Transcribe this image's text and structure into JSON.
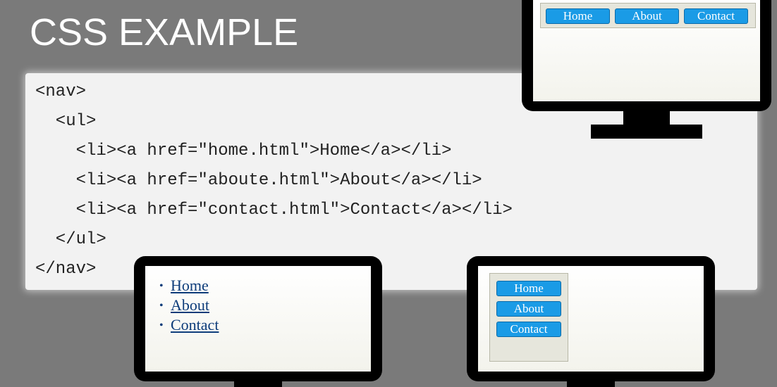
{
  "slide": {
    "title": "CSS EXAMPLE"
  },
  "code": {
    "lines": [
      "<nav>",
      "  <ul>",
      "    <li><a href=\"home.html\">Home</a></li>",
      "    <li><a href=\"aboute.html\">About</a></li>",
      "    <li><a href=\"contact.html\">Contact</a></li>",
      "  </ul>",
      "</nav>"
    ]
  },
  "monitor_top_right": {
    "nav_items": [
      "Home",
      "About",
      "Contact"
    ]
  },
  "monitor_bottom_left": {
    "list_items": [
      "Home",
      "About",
      "Contact"
    ],
    "bullet": "•"
  },
  "monitor_bottom_right": {
    "nav_items": [
      "Home",
      "About",
      "Contact"
    ]
  },
  "colors": {
    "background": "#7a7a7a",
    "code_panel": "#f2f2f2",
    "nav_button": "#1a9be6",
    "link": "#0d3c7a"
  }
}
